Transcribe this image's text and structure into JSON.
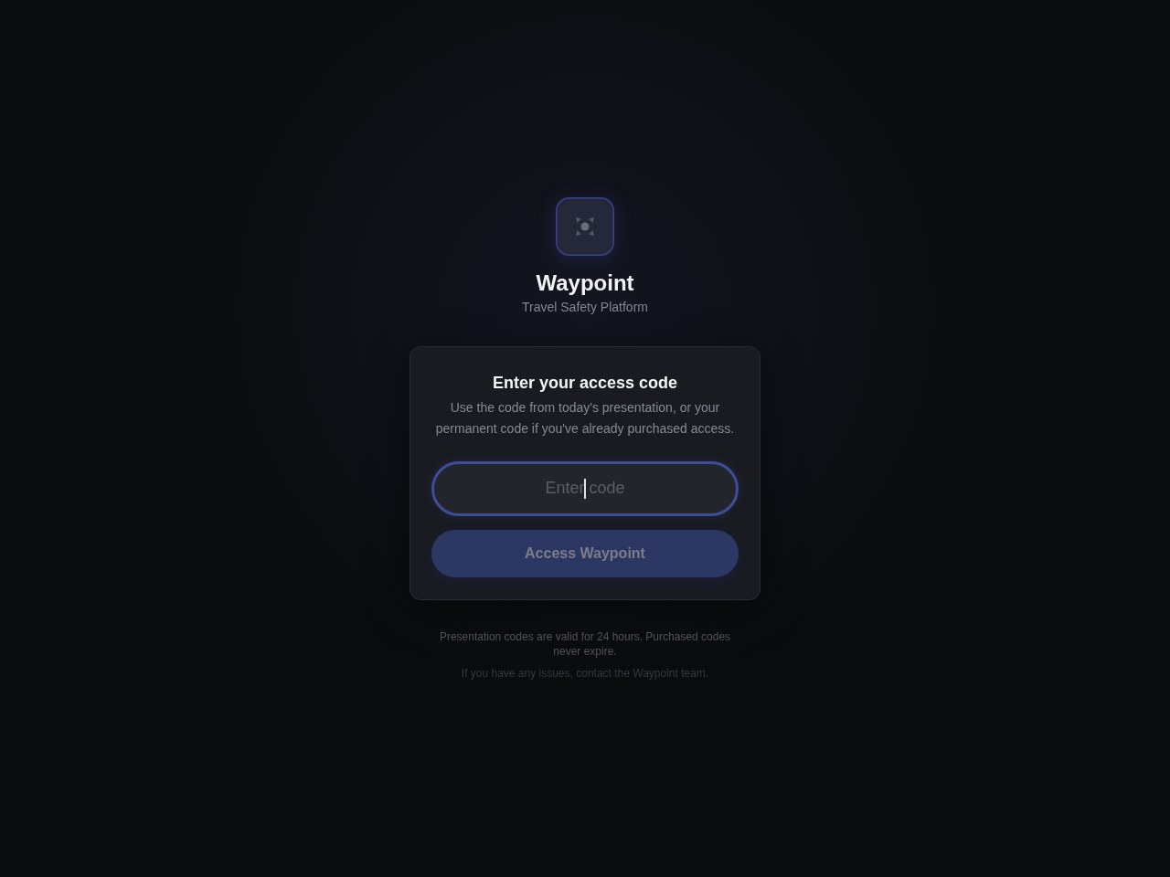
{
  "brand": {
    "name": "Waypoint",
    "tagline": "Travel Safety Platform"
  },
  "card": {
    "title": "Enter your access code",
    "description": "Use the code from today's presentation, or your permanent code if you've already purchased access.",
    "code_field": {
      "placeholder": "Enter code",
      "focused": true
    },
    "submit_button": {
      "label": "Access Waypoint",
      "disabled": true
    }
  },
  "footer": {
    "validity_note": "Presentation codes are valid for 24 hours. Purchased codes never expire.",
    "help_note": "If you have any issues, contact the Waypoint team."
  }
}
